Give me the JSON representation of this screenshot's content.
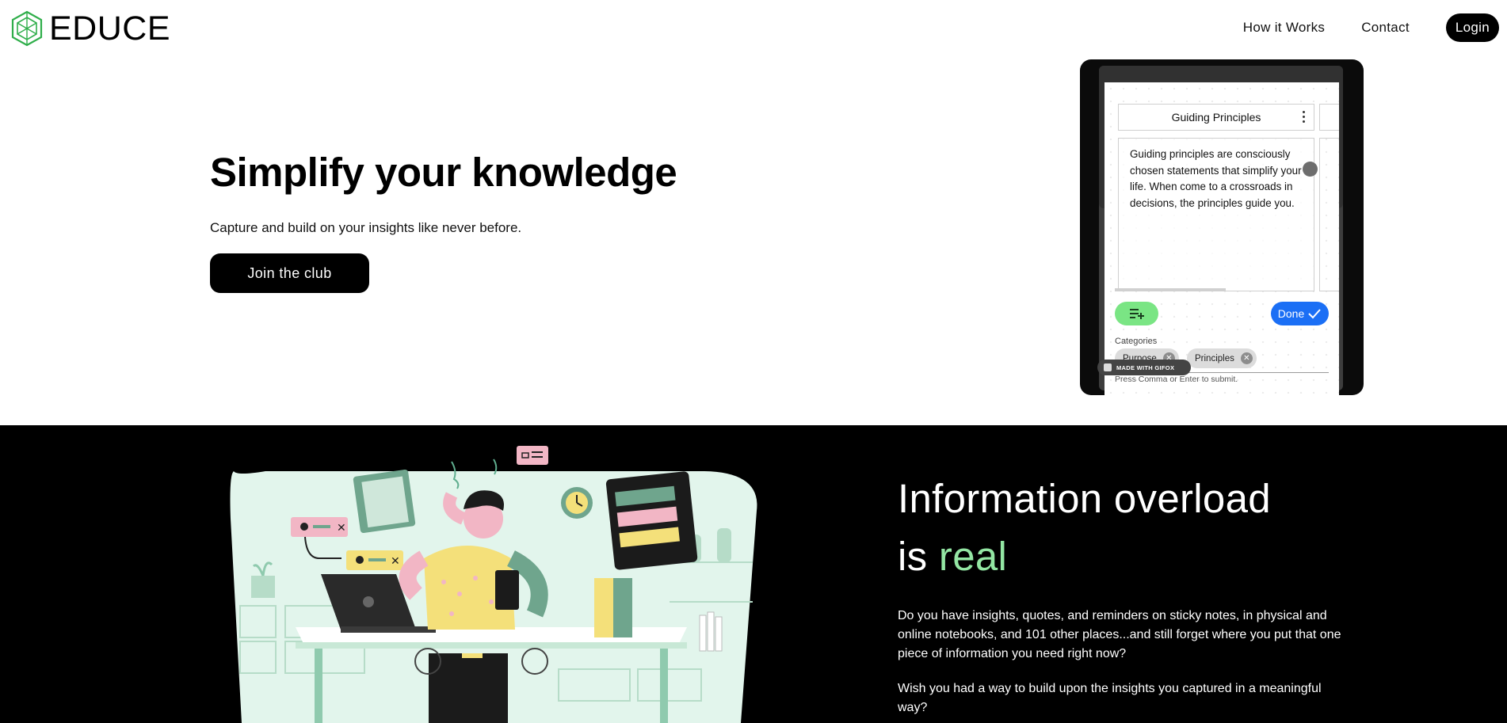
{
  "brand": {
    "name": "EDUCE",
    "accent": "#2fae4a"
  },
  "nav": {
    "how_it_works": "How it Works",
    "contact": "Contact",
    "login": "Login"
  },
  "hero": {
    "title": "Simplify your knowledge",
    "subtitle": "Capture and build on your insights like never before.",
    "cta": "Join the club"
  },
  "demo": {
    "card_title": "Guiding Principles",
    "card_body": "Guiding principles are consciously chosen statements that simplify your life. When come to a crossroads in decisions, the principles guide you.",
    "done_label": "Done",
    "categories_label": "Categories",
    "chips": [
      "Purpose",
      "Principles"
    ],
    "hint": "Press Comma or Enter to submit.",
    "watermark": "MADE WITH GIFOX",
    "add_color": "#7ae584",
    "done_color": "#1b6ff5"
  },
  "info": {
    "title_line1": "Information overload",
    "title_is": "is",
    "title_accent": "real",
    "accent_color": "#93e6a3",
    "paragraph1": "Do you have insights, quotes, and reminders on sticky notes, in physical and online notebooks, and 101 other places...and still forget where you put that one piece of information you need right now?",
    "paragraph2": "Wish you had a way to build upon the insights you captured in a meaningful way?"
  }
}
